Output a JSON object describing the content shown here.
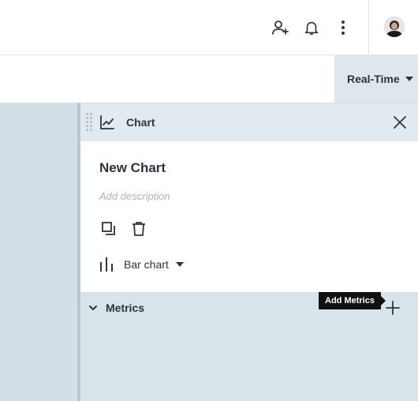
{
  "header": {
    "icons": [
      "user-add-icon",
      "bell-icon",
      "more-vertical-icon"
    ],
    "avatar": "user-avatar"
  },
  "toolbar": {
    "time_range": "Real-Time"
  },
  "panel": {
    "title": "Chart",
    "chart_name": "New Chart",
    "description_placeholder": "Add description",
    "chart_type": "Bar chart",
    "metrics_label": "Metrics",
    "add_metrics_tooltip": "Add Metrics"
  },
  "colors": {
    "canvas": "#d3dee6",
    "panel_header": "#e1eaf0",
    "dropdown_bg": "#dfe7ee",
    "text": "#2b3440",
    "placeholder": "#aab4bd",
    "tooltip_bg": "#111111"
  }
}
